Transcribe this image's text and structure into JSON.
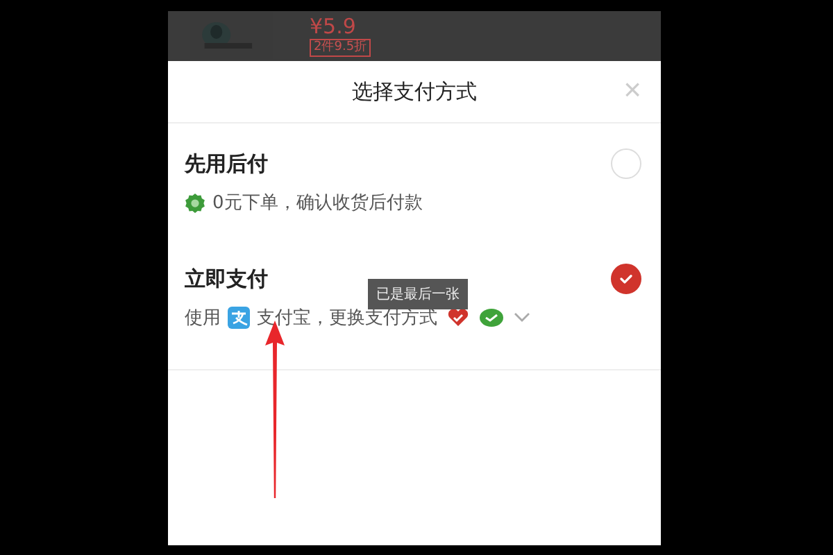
{
  "product": {
    "price": "¥5.9",
    "tag": "2件9.5折"
  },
  "sheet": {
    "title": "选择支付方式",
    "close": "×"
  },
  "options": [
    {
      "kind": "credit",
      "title": "先用后付",
      "selected": false,
      "note": "0元下单，确认收货后付款"
    },
    {
      "kind": "pay",
      "title": "立即支付",
      "selected": true,
      "lead": "使用",
      "note": "支付宝，更换支付方式"
    }
  ],
  "tooltip": {
    "text": "已是最后一张"
  }
}
